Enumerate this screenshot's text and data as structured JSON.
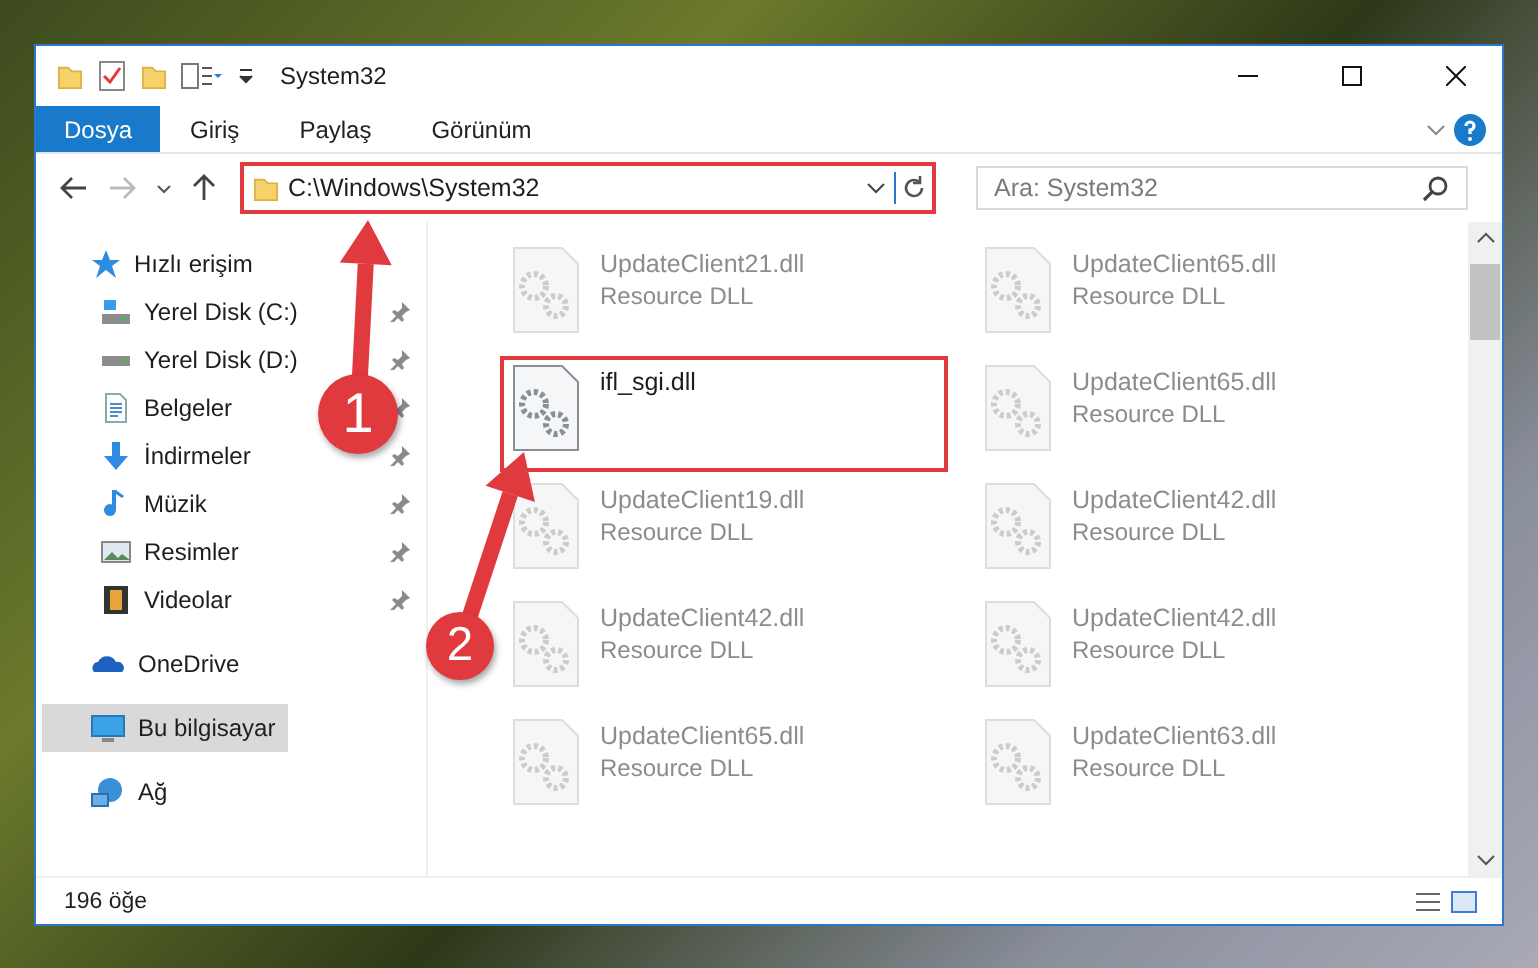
{
  "window": {
    "title": "System32"
  },
  "ribbon_tabs": [
    {
      "label": "Dosya",
      "kind": "file"
    },
    {
      "label": "Giriş",
      "kind": "tab"
    },
    {
      "label": "Paylaş",
      "kind": "tab"
    },
    {
      "label": "Görünüm",
      "kind": "tab"
    }
  ],
  "address_bar": {
    "value": "C:\\Windows\\System32",
    "highlighted": true
  },
  "search": {
    "placeholder": "Ara: System32"
  },
  "sidebar": {
    "items": [
      {
        "label": "Hızlı erişim",
        "kind": "star",
        "selected": false,
        "children": [
          {
            "label": "Yerel Disk (C:)",
            "kind": "system-drive",
            "pinned": true,
            "selected": false
          },
          {
            "label": "Yerel Disk (D:)",
            "kind": "drive",
            "pinned": true,
            "selected": false
          },
          {
            "label": "Belgeler",
            "kind": "document",
            "pinned": true,
            "selected": false
          },
          {
            "label": "İndirmeler",
            "kind": "download",
            "pinned": true,
            "selected": false
          },
          {
            "label": "Müzik",
            "kind": "music",
            "pinned": true,
            "selected": false
          },
          {
            "label": "Resimler",
            "kind": "picture",
            "pinned": true,
            "selected": false
          },
          {
            "label": "Videolar",
            "kind": "video",
            "pinned": true,
            "selected": false
          }
        ]
      },
      {
        "label": "OneDrive",
        "kind": "cloud",
        "selected": false
      },
      {
        "label": "Bu bilgisayar",
        "kind": "computer",
        "selected": true
      },
      {
        "label": "Ağ",
        "kind": "network",
        "selected": false
      }
    ]
  },
  "files": [
    {
      "name": "UpdateClient21.dll",
      "subtitle": "Resource DLL",
      "blurred": true,
      "highlighted": false
    },
    {
      "name": "UpdateClient65.dll",
      "subtitle": "Resource DLL",
      "blurred": true,
      "highlighted": false
    },
    {
      "name": "ifl_sgi.dll",
      "blurred": false,
      "highlighted": true
    },
    {
      "name": "UpdateClient65.dll",
      "subtitle": "Resource DLL",
      "blurred": true,
      "highlighted": false
    },
    {
      "name": "UpdateClient19.dll",
      "subtitle": "Resource DLL",
      "blurred": true,
      "highlighted": false
    },
    {
      "name": "UpdateClient42.dll",
      "subtitle": "Resource DLL",
      "blurred": true,
      "highlighted": false
    },
    {
      "name": "UpdateClient42.dll",
      "subtitle": "Resource DLL",
      "blurred": true,
      "highlighted": false
    },
    {
      "name": "UpdateClient42.dll",
      "subtitle": "Resource DLL",
      "blurred": true,
      "highlighted": false
    },
    {
      "name": "UpdateClient65.dll",
      "subtitle": "Resource DLL",
      "blurred": true,
      "highlighted": false
    },
    {
      "name": "UpdateClient63.dll",
      "subtitle": "Resource DLL",
      "blurred": true,
      "highlighted": false
    }
  ],
  "status_bar": {
    "count": "196 öğe"
  },
  "callouts": [
    {
      "number": "1"
    },
    {
      "number": "2"
    }
  ]
}
